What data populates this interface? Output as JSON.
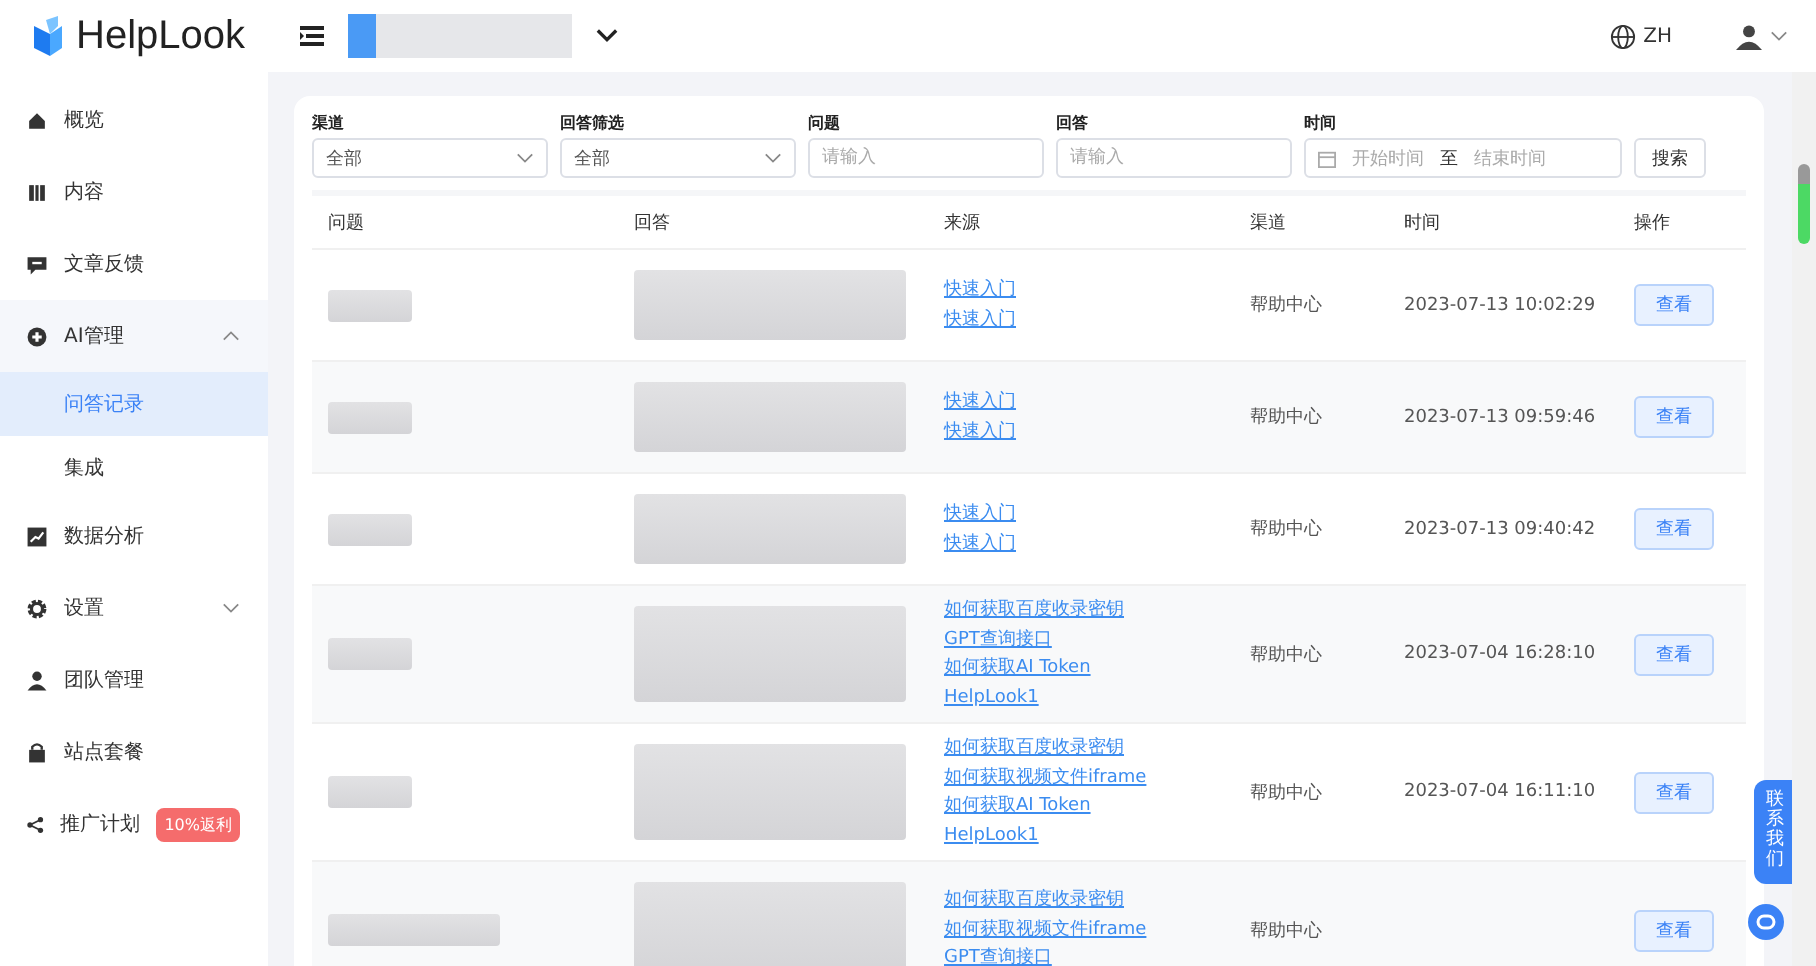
{
  "header": {
    "logo_text": "HelpLook",
    "language": "ZH"
  },
  "sidebar": {
    "items": [
      {
        "kind": "home",
        "label": "概览",
        "selected": false
      },
      {
        "kind": "book",
        "label": "内容",
        "selected": false
      },
      {
        "kind": "comment",
        "label": "文章反馈",
        "selected": false
      },
      {
        "kind": "plus",
        "label": "AI管理",
        "expanded": true,
        "selected": false,
        "children": [
          {
            "label": "问答记录",
            "selected": true
          },
          {
            "label": "集成",
            "selected": false
          }
        ]
      },
      {
        "kind": "chart",
        "label": "数据分析",
        "selected": false
      },
      {
        "kind": "gear",
        "label": "设置",
        "expanded": false,
        "selected": false
      },
      {
        "kind": "user",
        "label": "团队管理",
        "selected": false
      },
      {
        "kind": "bag",
        "label": "站点套餐",
        "selected": false
      },
      {
        "kind": "share",
        "label": "推广计划",
        "badge": "10%返利",
        "selected": false
      }
    ]
  },
  "filters": [
    {
      "kind": "select",
      "label": "渠道",
      "value": "全部"
    },
    {
      "kind": "select",
      "label": "回答筛选",
      "value": "全部"
    },
    {
      "kind": "input",
      "label": "问题",
      "placeholder": "请输入"
    },
    {
      "kind": "input",
      "label": "回答",
      "placeholder": "请输入"
    },
    {
      "kind": "daterange",
      "label": "时间",
      "start_placeholder": "开始时间",
      "separator": "至",
      "end_placeholder": "结束时间"
    }
  ],
  "search_button": "搜索",
  "table": {
    "columns": [
      "问题",
      "回答",
      "来源",
      "渠道",
      "时间",
      "操作"
    ],
    "rows": [
      {
        "sources": [
          "快速入门",
          "快速入门"
        ],
        "channel": "帮助中心",
        "time": "2023-07-13 10:02:29",
        "action": "查看"
      },
      {
        "sources": [
          "快速入门",
          "快速入门"
        ],
        "channel": "帮助中心",
        "time": "2023-07-13 09:59:46",
        "action": "查看"
      },
      {
        "sources": [
          "快速入门",
          "快速入门"
        ],
        "channel": "帮助中心",
        "time": "2023-07-13 09:40:42",
        "action": "查看"
      },
      {
        "sources": [
          "如何获取百度收录密钥",
          "GPT查询接口",
          "如何获取AI Token",
          "HelpLook1"
        ],
        "channel": "帮助中心",
        "time": "2023-07-04 16:28:10",
        "action": "查看"
      },
      {
        "sources": [
          "如何获取百度收录密钥",
          "如何获取视频文件iframe",
          "如何获取AI Token",
          "HelpLook1"
        ],
        "channel": "帮助中心",
        "time": "2023-07-04 16:11:10",
        "action": "查看"
      },
      {
        "sources": [
          "如何获取百度收录密钥",
          "如何获取视频文件iframe",
          "GPT查询接口"
        ],
        "channel": "帮助中心",
        "action": "查看"
      }
    ]
  },
  "contact_button": "联系我们"
}
